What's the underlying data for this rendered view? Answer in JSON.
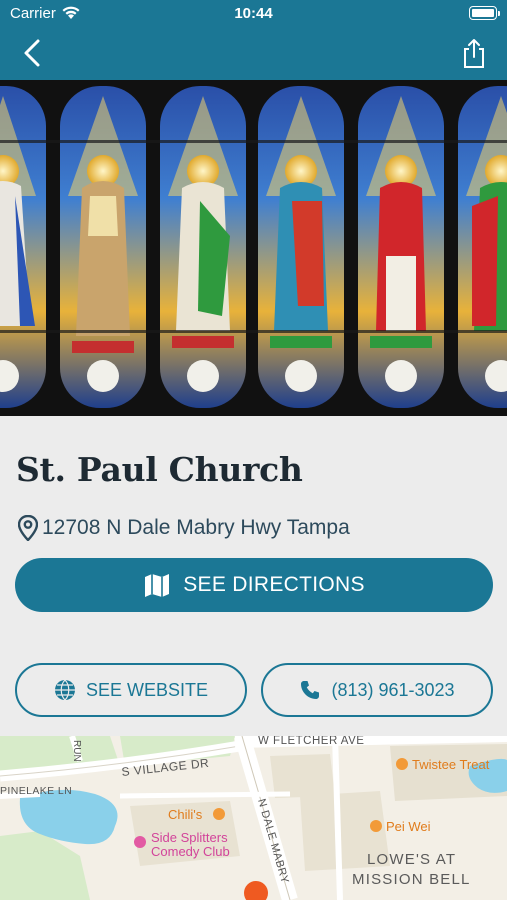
{
  "status_bar": {
    "carrier": "Carrier",
    "time": "10:44"
  },
  "nav": {
    "back_icon": "chevron-left-icon",
    "share_icon": "share-icon"
  },
  "church": {
    "name": "St. Paul Church",
    "address": "12708 N Dale Mabry Hwy Tampa"
  },
  "actions": {
    "directions_label": "SEE DIRECTIONS",
    "website_label": "SEE WEBSITE",
    "phone_label": "(813) 961-3023"
  },
  "map": {
    "streets": [
      "W FLETCHER AVE",
      "S VILLAGE DR",
      "PINELAKE LN",
      "N DALE MABRY",
      "RUN"
    ],
    "places": [
      "Twistee Treat",
      "Chili's",
      "Side Splitters",
      "Comedy Club",
      "Pei Wei",
      "LOWE'S AT",
      "MISSION BELL"
    ]
  },
  "colors": {
    "brand": "#1b7795",
    "title": "#1e2a33",
    "background": "#ececec"
  }
}
